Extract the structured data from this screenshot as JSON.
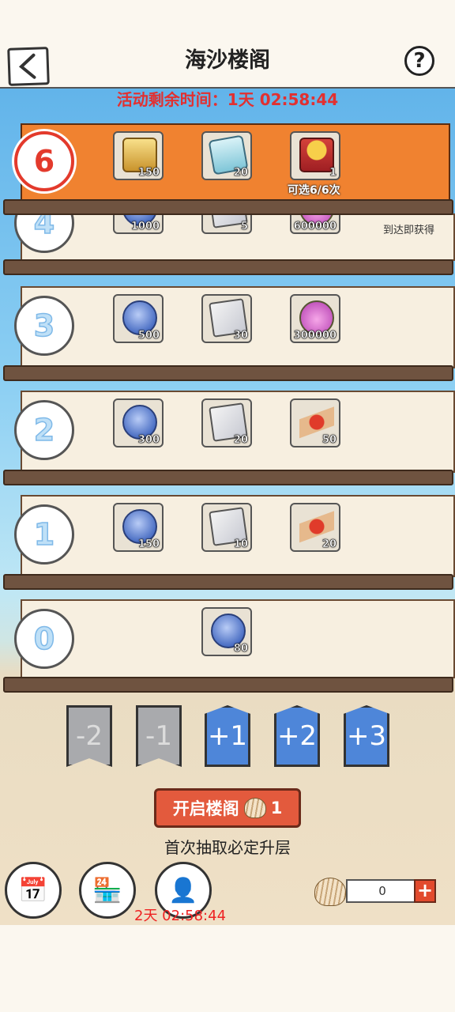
{
  "header": {
    "title": "海沙楼阁",
    "help": "?"
  },
  "timer": "活动剩余时间：1天 02:58:44",
  "top_floor": {
    "level": "6",
    "items": [
      {
        "icon": "gold-token-icon",
        "count": "150"
      },
      {
        "icon": "cyan-charm-icon",
        "count": "20"
      },
      {
        "icon": "gift-box-icon",
        "count": "1"
      }
    ],
    "caption": "可选6/6次"
  },
  "floors": [
    {
      "level": "4",
      "items": [
        "1000",
        "5",
        "600000"
      ],
      "note": "到达即获得"
    },
    {
      "level": "3",
      "items": [
        "500",
        "30",
        "300000"
      ]
    },
    {
      "level": "2",
      "items": [
        "300",
        "20",
        "50"
      ]
    },
    {
      "level": "1",
      "items": [
        "150",
        "10",
        "20"
      ]
    },
    {
      "level": "0",
      "items": [
        "80"
      ]
    }
  ],
  "steps": [
    "-2",
    "-1",
    "+1",
    "+2",
    "+3"
  ],
  "open_button": {
    "label": "开启楼阁",
    "count": "1"
  },
  "hint": "首次抽取必定升层",
  "countdown": "2天 02:58:44",
  "currency": {
    "value": "0"
  }
}
